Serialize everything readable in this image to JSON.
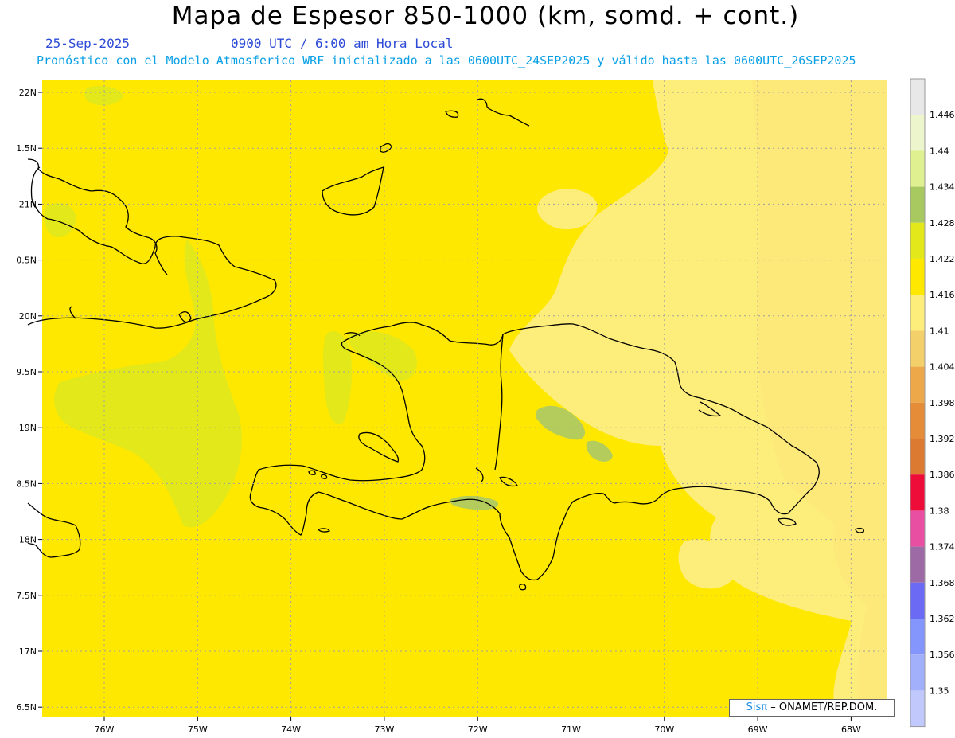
{
  "header": {
    "title": "Mapa de Espesor 850-1000 (km, somd. + cont.)",
    "date": "25-Sep-2025",
    "time": "0900 UTC / 6:00 am Hora Local",
    "subtitle": "Pronóstico con el Modelo Atmosferico WRF inicializado a las 0600UTC_24SEP2025 y válido hasta las  0600UTC_26SEP2025"
  },
  "map": {
    "lon_range": [
      -76.7,
      -67.6
    ],
    "lat_range": [
      6.4,
      22.1
    ],
    "lat_ticks": [
      "22N",
      "1.5N",
      "21N",
      "0.5N",
      "20N",
      "9.5N",
      "19N",
      "8.5N",
      "18N",
      "7.5N",
      "17N",
      "6.5N"
    ],
    "lon_ticks": [
      "76W",
      "75W",
      "74W",
      "73W",
      "72W",
      "71W",
      "70W",
      "69W",
      "68W"
    ],
    "field_colors": {
      "main": "#ffe800",
      "light": "#fded7a",
      "green": "#e3e81a",
      "olive": "#b3cc5c",
      "coast": "#000000"
    }
  },
  "colorbar": {
    "levels": [
      "1.446",
      "1.44",
      "1.434",
      "1.428",
      "1.422",
      "1.416",
      "1.41",
      "1.404",
      "1.398",
      "1.392",
      "1.386",
      "1.38",
      "1.374",
      "1.368",
      "1.362",
      "1.356",
      "1.35"
    ],
    "colors": [
      "#e8e8e8",
      "#edf5cc",
      "#dff090",
      "#a8c860",
      "#e3e81a",
      "#ffe800",
      "#fded7a",
      "#f4d06a",
      "#eda84a",
      "#e48c38",
      "#dd7a32",
      "#ee0c38",
      "#e84ea2",
      "#9e6aa6",
      "#6a6af4",
      "#8496fc",
      "#a2b0fc",
      "#c0c8fc"
    ]
  },
  "credit": {
    "brand": "Sisπ",
    "text": "– ONAMET/REP.DOM."
  }
}
